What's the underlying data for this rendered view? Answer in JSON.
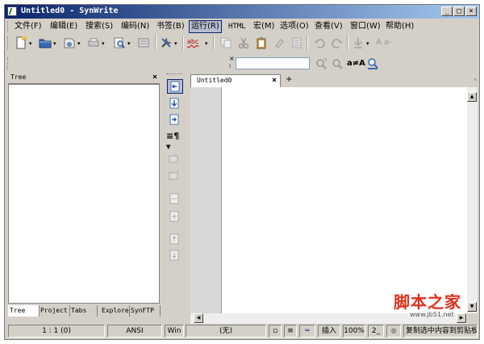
{
  "window": {
    "title": "Untitled0 - SynWrite",
    "buttons": {
      "minimize": "_",
      "maximize": "□",
      "close": "×"
    }
  },
  "menu": [
    "文件(F)",
    "编辑(E)",
    "搜索(S)",
    "编码(N)",
    "书签(B)",
    "运行(R)",
    "HTML",
    "宏(M)",
    "选项(O)",
    "查看(V)",
    "窗口(W)",
    "帮助(H)"
  ],
  "toolbar": {
    "font_button": "A a-",
    "case_button": "a≠A",
    "spell_label": "abc",
    "search_field": {
      "value": "",
      "placeholder": ""
    }
  },
  "panel": {
    "title": "Tree",
    "close": "×",
    "tabs": [
      "Tree",
      "Project",
      "Tabs",
      "Explore",
      "SynFTP"
    ]
  },
  "editor": {
    "tab_label": "Untitled0",
    "tab_close": "×",
    "add_tab": "+"
  },
  "status": {
    "position": "1 : 1 (0)",
    "encoding": "ANSI",
    "line_end": "Win",
    "lexer": "(无)",
    "insert_mode": "插入",
    "zoom": "100%",
    "wrap": "2_",
    "message": "复制选中内容到剪贴板"
  },
  "watermark": {
    "text": "脚本之家",
    "url": "www.jb51.net"
  },
  "colors": {
    "titlebar_start": "#0a246a",
    "titlebar_end": "#a6caf0",
    "face": "#d4d0c8"
  }
}
